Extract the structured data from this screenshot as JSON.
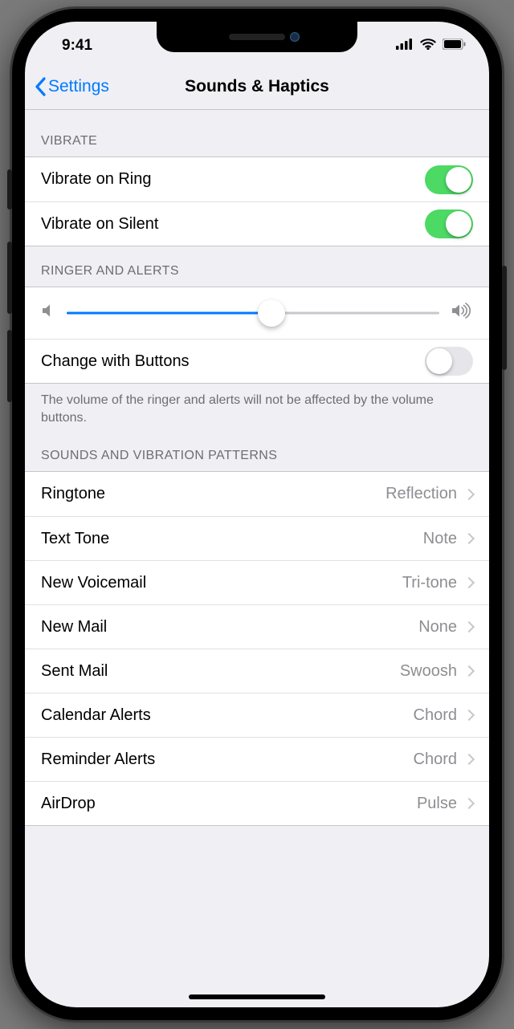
{
  "status": {
    "time": "9:41"
  },
  "nav": {
    "back": "Settings",
    "title": "Sounds & Haptics"
  },
  "sections": {
    "vibrate": {
      "header": "VIBRATE",
      "items": [
        {
          "label": "Vibrate on Ring",
          "on": true
        },
        {
          "label": "Vibrate on Silent",
          "on": true
        }
      ]
    },
    "ringer": {
      "header": "RINGER AND ALERTS",
      "slider_value": 0.55,
      "change_with_buttons": {
        "label": "Change with Buttons",
        "on": false
      },
      "footer": "The volume of the ringer and alerts will not be affected by the volume buttons."
    },
    "patterns": {
      "header": "SOUNDS AND VIBRATION PATTERNS",
      "items": [
        {
          "label": "Ringtone",
          "value": "Reflection"
        },
        {
          "label": "Text Tone",
          "value": "Note"
        },
        {
          "label": "New Voicemail",
          "value": "Tri-tone"
        },
        {
          "label": "New Mail",
          "value": "None"
        },
        {
          "label": "Sent Mail",
          "value": "Swoosh"
        },
        {
          "label": "Calendar Alerts",
          "value": "Chord"
        },
        {
          "label": "Reminder Alerts",
          "value": "Chord"
        },
        {
          "label": "AirDrop",
          "value": "Pulse"
        }
      ]
    }
  }
}
